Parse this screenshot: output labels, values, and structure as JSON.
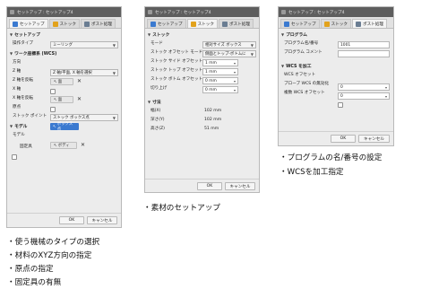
{
  "panel1": {
    "title": "セットアップ : セットアップ4",
    "tabs": [
      "セットアップ",
      "ストック",
      "ポスト処理"
    ],
    "section_setup": "セットアップ",
    "operation_type_label": "操作タイプ",
    "operation_type_value": "ミーリング",
    "section_wcs": "ワーク座標系 (WCS)",
    "orientation_label": "方向",
    "orientation_value": "Z 軸/平面, X 軸を選択",
    "z_axis_label": "Z 軸",
    "z_axis_selection": "面",
    "z_flip_label": "Z 軸を反転",
    "x_axis_label": "X 軸",
    "x_axis_selection": "面",
    "x_flip_label": "X 軸を反転",
    "origin_label": "原点",
    "origin_value": "ストック ボックス点",
    "stock_point_label": "ストック ポイント",
    "stock_point_button": "ボックス点",
    "section_model": "モデル",
    "model_label": "モデル",
    "model_selection": "ボディ",
    "fixture_label": "固定具",
    "ok": "OK",
    "cancel": "キャンセル"
  },
  "panel2": {
    "title": "セットアップ : セットアップ4",
    "tabs": [
      "セットアップ",
      "ストック",
      "ポスト処理"
    ],
    "section_stock": "ストック",
    "mode_label": "モード",
    "mode_value": "相対サイズ ボックス",
    "offset_mode_label": "ストック オフセット モード",
    "offset_mode_value": "側面とトップ-ボトムに",
    "side_offset_label": "ストック サイド オフセット",
    "side_offset_value": "1 mm",
    "top_offset_label": "ストック トップ オフセット",
    "top_offset_value": "1 mm",
    "bottom_offset_label": "ストック ボトム オフセット",
    "bottom_offset_value": "0 mm",
    "roundup_label": "切り上げ",
    "roundup_value": "0 mm",
    "section_dims": "寸法",
    "width_label": "幅(X)",
    "width_value": "102 mm",
    "depth_label": "深さ(Y)",
    "depth_value": "102 mm",
    "height_label": "高さ(Z)",
    "height_value": "51 mm",
    "ok": "OK",
    "cancel": "キャンセル"
  },
  "panel3": {
    "title": "セットアップ : セットアップ4",
    "tabs": [
      "セットアップ",
      "ストック",
      "ポスト処理"
    ],
    "section_program": "プログラム",
    "program_name_label": "プログラム名/番号",
    "program_name_value": "1001",
    "program_comment_label": "プログラム コメント",
    "program_comment_value": "",
    "section_wcs": "WCS を加工",
    "wcs_offset_label": "WCS オフセット",
    "wcs_offset_value": "0",
    "probe_label": "プローブ WCS の無効化",
    "probe_value": "0",
    "multi_wcs_label": "複数 WCS オフセット",
    "ok": "OK",
    "cancel": "キャンセル"
  },
  "captions": {
    "stock_caption": "・素材のセットアップ",
    "program_lines": [
      "・プログラムの名/番号の設定",
      "・WCSを加工指定"
    ],
    "setup_lines": [
      "・使う機械のタイプの選択",
      "・材料のXYZ方向の指定",
      "・原点の指定",
      "・固定具の有無"
    ]
  }
}
